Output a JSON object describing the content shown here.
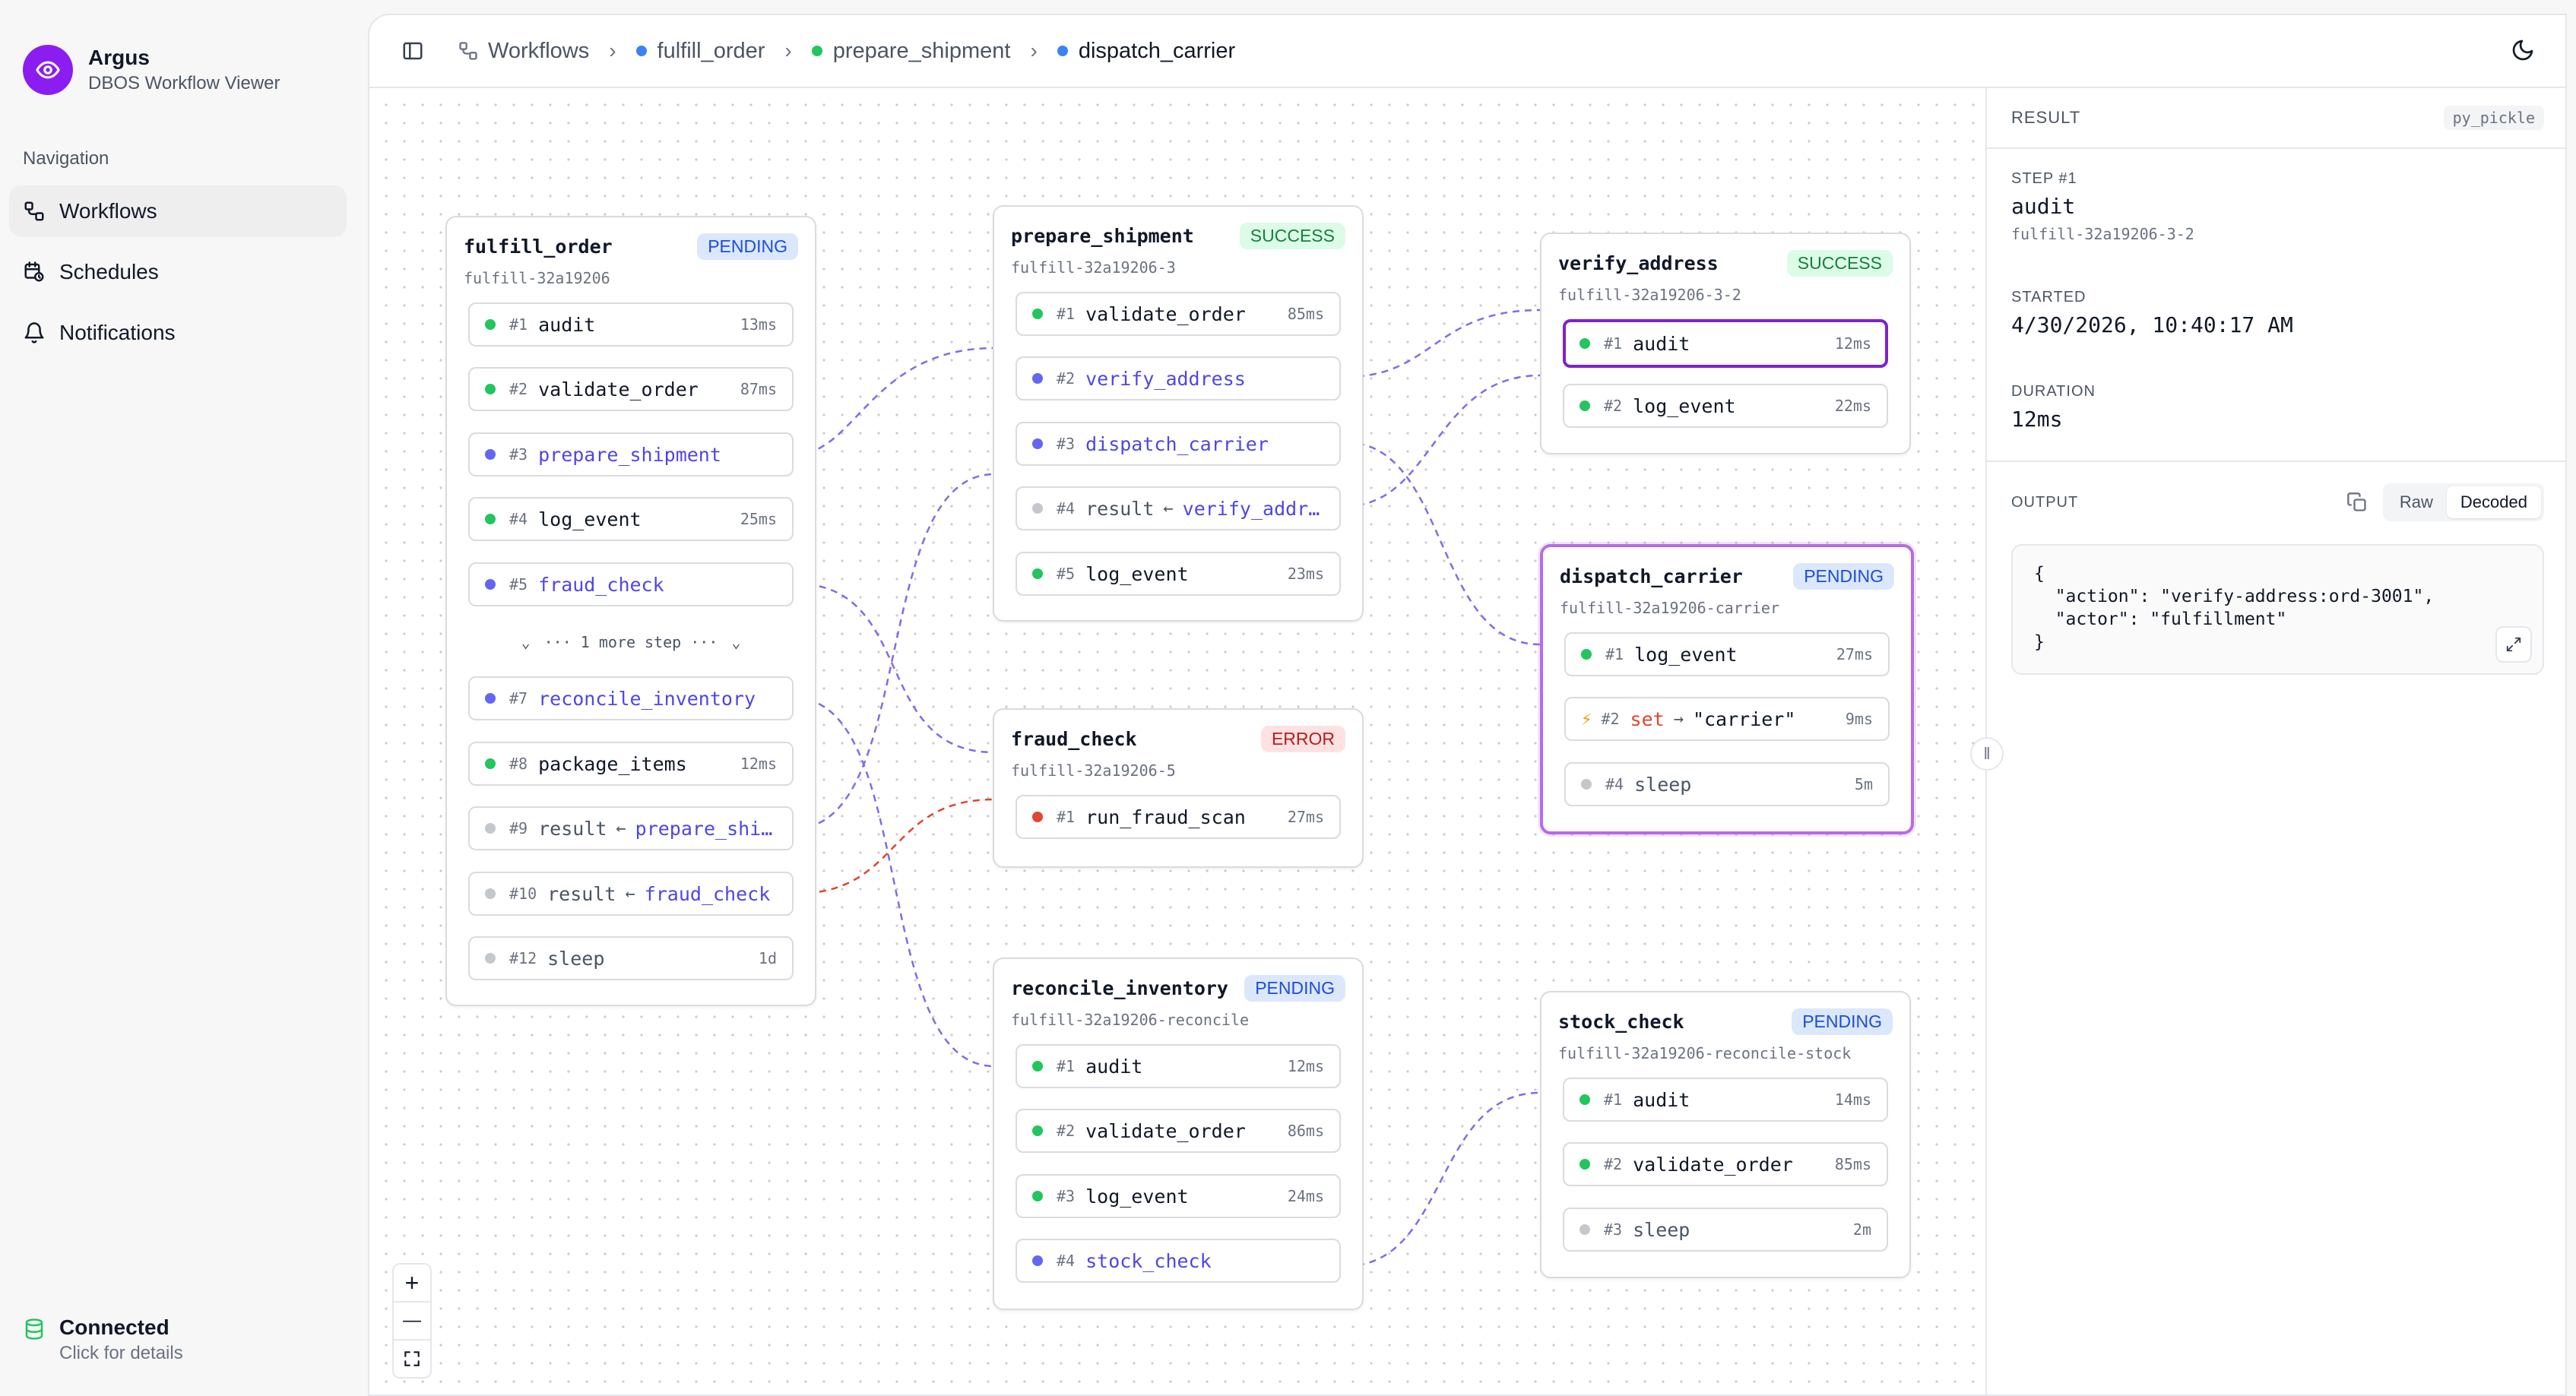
{
  "brand": {
    "name": "Argus",
    "subtitle": "DBOS Workflow Viewer"
  },
  "nav": {
    "label": "Navigation",
    "items": [
      {
        "label": "Workflows",
        "icon": "workflow-icon"
      },
      {
        "label": "Schedules",
        "icon": "calendar-clock-icon"
      },
      {
        "label": "Notifications",
        "icon": "bell-icon"
      }
    ]
  },
  "connection": {
    "title": "Connected",
    "subtitle": "Click for details"
  },
  "breadcrumb": [
    {
      "label": "Workflows"
    },
    {
      "label": "fulfill_order",
      "color": "#3b82f6"
    },
    {
      "label": "prepare_shipment",
      "color": "#22c55e"
    },
    {
      "label": "dispatch_carrier",
      "color": "#3b82f6"
    }
  ],
  "nodes": {
    "fulfill_order": {
      "title": "fulfill_order",
      "status": "PENDING",
      "id": "fulfill-32a19206",
      "steps": [
        {
          "num": "#1",
          "name": "audit",
          "dur": "13ms"
        },
        {
          "num": "#2",
          "name": "validate_order",
          "dur": "87ms"
        },
        {
          "num": "#3",
          "name": "prepare_shipment"
        },
        {
          "num": "#4",
          "name": "log_event",
          "dur": "25ms"
        },
        {
          "num": "#5",
          "name": "fraud_check"
        },
        {
          "num": "#7",
          "name": "reconcile_inventory"
        },
        {
          "num": "#8",
          "name": "package_items",
          "dur": "12ms"
        },
        {
          "num": "#9",
          "name": "result",
          "target": "prepare_shipment"
        },
        {
          "num": "#10",
          "name": "result",
          "target": "fraud_check"
        },
        {
          "num": "#12",
          "name": "sleep",
          "dur": "1d"
        }
      ],
      "more": "··· 1 more step ···"
    },
    "prepare_shipment": {
      "title": "prepare_shipment",
      "status": "SUCCESS",
      "id": "fulfill-32a19206-3",
      "steps": [
        {
          "num": "#1",
          "name": "validate_order",
          "dur": "85ms"
        },
        {
          "num": "#2",
          "name": "verify_address"
        },
        {
          "num": "#3",
          "name": "dispatch_carrier"
        },
        {
          "num": "#4",
          "name": "result",
          "target": "verify_address"
        },
        {
          "num": "#5",
          "name": "log_event",
          "dur": "23ms"
        }
      ]
    },
    "fraud_check": {
      "title": "fraud_check",
      "status": "ERROR",
      "id": "fulfill-32a19206-5",
      "steps": [
        {
          "num": "#1",
          "name": "run_fraud_scan",
          "dur": "27ms"
        }
      ]
    },
    "reconcile_inventory": {
      "title": "reconcile_inventory",
      "status": "PENDING",
      "id": "fulfill-32a19206-reconcile",
      "steps": [
        {
          "num": "#1",
          "name": "audit",
          "dur": "12ms"
        },
        {
          "num": "#2",
          "name": "validate_order",
          "dur": "86ms"
        },
        {
          "num": "#3",
          "name": "log_event",
          "dur": "24ms"
        },
        {
          "num": "#4",
          "name": "stock_check"
        }
      ]
    },
    "verify_address": {
      "title": "verify_address",
      "status": "SUCCESS",
      "id": "fulfill-32a19206-3-2",
      "steps": [
        {
          "num": "#1",
          "name": "audit",
          "dur": "12ms"
        },
        {
          "num": "#2",
          "name": "log_event",
          "dur": "22ms"
        }
      ]
    },
    "dispatch_carrier": {
      "title": "dispatch_carrier",
      "status": "PENDING",
      "id": "fulfill-32a19206-carrier",
      "steps": [
        {
          "num": "#1",
          "name": "log_event",
          "dur": "27ms"
        },
        {
          "num": "#2",
          "name": "set",
          "value": "\"carrier\"",
          "dur": "9ms"
        },
        {
          "num": "#4",
          "name": "sleep",
          "dur": "5m"
        }
      ]
    },
    "stock_check": {
      "title": "stock_check",
      "status": "PENDING",
      "id": "fulfill-32a19206-reconcile-stock",
      "steps": [
        {
          "num": "#1",
          "name": "audit",
          "dur": "14ms"
        },
        {
          "num": "#2",
          "name": "validate_order",
          "dur": "85ms"
        },
        {
          "num": "#3",
          "name": "sleep",
          "dur": "2m"
        }
      ]
    }
  },
  "zoom_controls": {
    "zoom_in": "+",
    "zoom_out": "—"
  },
  "result_panel": {
    "title": "RESULT",
    "format": "py_pickle",
    "step_label": "STEP #1",
    "step_name": "audit",
    "step_id": "fulfill-32a19206-3-2",
    "started_label": "STARTED",
    "started": "4/30/2026, 10:40:17 AM",
    "duration_label": "DURATION",
    "duration": "12ms",
    "output_label": "OUTPUT",
    "raw_label": "Raw",
    "decoded_label": "Decoded",
    "output": "{\n  \"action\": \"verify-address:ord-3001\",\n  \"actor\": \"fulfillment\"\n}"
  }
}
